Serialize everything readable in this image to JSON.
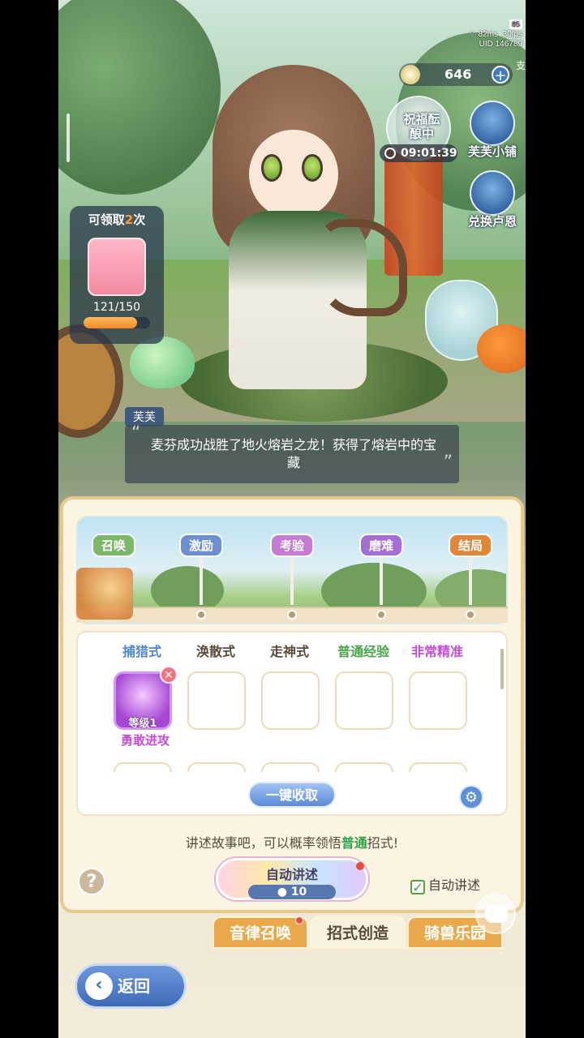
{
  "status": {
    "battery": "85",
    "latency": "82ms",
    "fps": "30fps",
    "uid_label": "UID",
    "uid": "146789"
  },
  "currency": {
    "amount": "646",
    "edge_text": "支"
  },
  "blessing": {
    "label": "祝福酝酿中",
    "timer": "09:01:39"
  },
  "side_buttons": {
    "shop": "芙芙小铺",
    "exchange": "兑换卢恩"
  },
  "reward_card": {
    "title_prefix": "可领取",
    "count": "2",
    "title_suffix": "次",
    "progress_text": "121/150",
    "progress": 0.807
  },
  "dialogue": {
    "speaker": "芙芙",
    "text": "麦芬成功战胜了地火熔岩之龙！获得了熔岩中的宝藏"
  },
  "stages": [
    {
      "label": "召唤",
      "color": "#7bb86a"
    },
    {
      "label": "激励",
      "color": "#6b8ed0"
    },
    {
      "label": "考验",
      "color": "#c57bd1"
    },
    {
      "label": "磨难",
      "color": "#a26fd6"
    },
    {
      "label": "结局",
      "color": "#e0873a"
    }
  ],
  "columns": [
    {
      "label": "捕猎式",
      "color": "#4d86cc"
    },
    {
      "label": "涣散式",
      "color": "#5a4a3a"
    },
    {
      "label": "走神式",
      "color": "#5a4a3a"
    },
    {
      "label": "普通经验",
      "color": "#47a54a"
    },
    {
      "label": "非常精准",
      "color": "#c34cd6"
    }
  ],
  "filled_slot": {
    "level": "等级1",
    "name": "勇敢进攻"
  },
  "collect_button": "一键收取",
  "hint": {
    "prefix": "讲述故事吧，可以概率领悟",
    "highlight": "普通",
    "suffix": "招式!"
  },
  "auto_button": {
    "label": "自动讲述",
    "cost": "10"
  },
  "auto_checkbox": "自动讲述",
  "tabs": [
    {
      "label": "音律召唤"
    },
    {
      "label": "招式创造"
    },
    {
      "label": "骑兽乐园"
    }
  ],
  "back_button": "返回"
}
